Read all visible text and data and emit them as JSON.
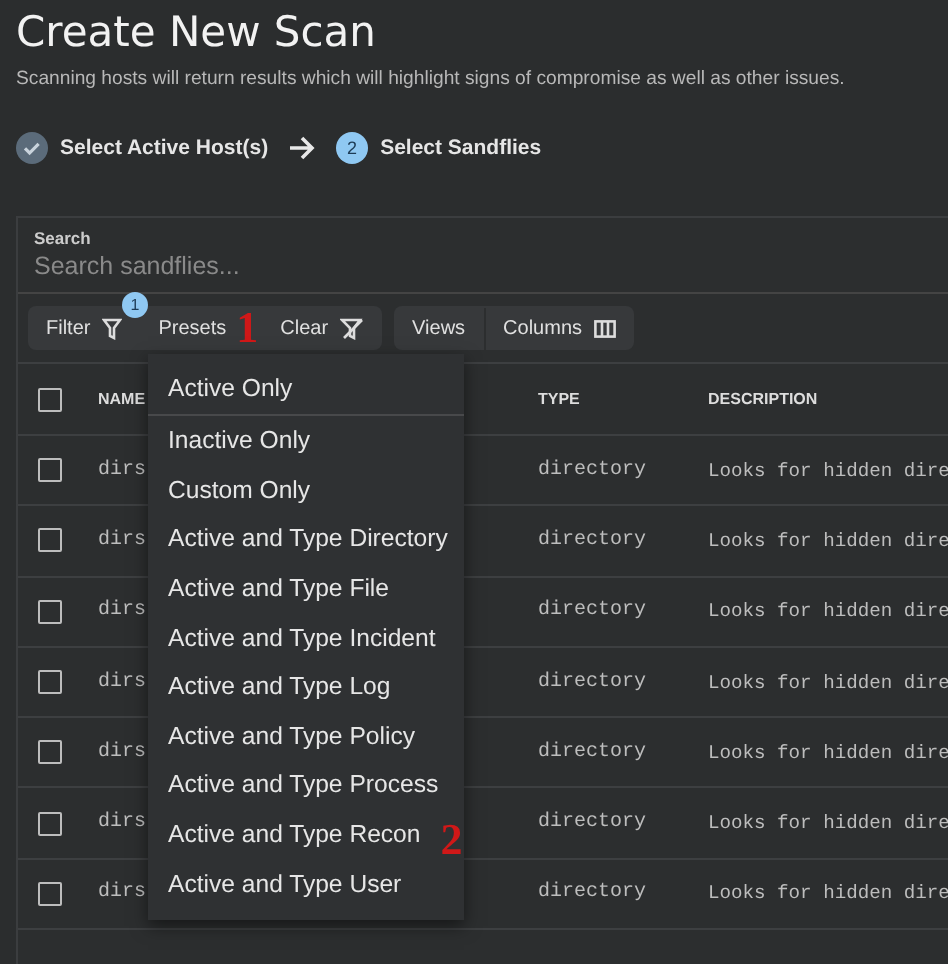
{
  "page": {
    "title": "Create New Scan",
    "subtitle": "Scanning hosts will return results which will highlight signs of compromise as well as other issues."
  },
  "steps": [
    {
      "label": "Select Active Host(s)",
      "done": true
    },
    {
      "label": "Select Sandflies",
      "number": "2",
      "done": false
    }
  ],
  "search": {
    "label": "Search",
    "placeholder": "Search sandflies..."
  },
  "toolbar": {
    "filter": {
      "label": "Filter",
      "badge": "1"
    },
    "presets": {
      "label": "Presets",
      "annotation": "1"
    },
    "clear": "Clear",
    "views": "Views",
    "columns": "Columns"
  },
  "table": {
    "all_checked": false,
    "columns": [
      "NAME",
      "TYPE",
      "DESCRIPTION"
    ],
    "rows": [
      {
        "name": "dirs",
        "type": "directory",
        "description": "Looks for hidden dire",
        "checked": false
      },
      {
        "name": "dirs",
        "type": "directory",
        "description": "Looks for hidden dire",
        "checked": false
      },
      {
        "name": "dirs",
        "type": "directory",
        "description": "Looks for hidden dire",
        "checked": false
      },
      {
        "name": "dirs",
        "type": "directory",
        "description": "Looks for hidden dire",
        "checked": false
      },
      {
        "name": "dirs",
        "type": "directory",
        "description": "Looks for hidden dire",
        "checked": false
      },
      {
        "name": "dirs",
        "type": "directory",
        "description": "Looks for hidden dire",
        "checked": false
      },
      {
        "name": "dirs",
        "type": "directory",
        "description": "Looks for hidden dire",
        "checked": false
      }
    ]
  },
  "presets_menu": {
    "items": [
      {
        "label": "Active Only",
        "selected": true
      },
      {
        "label": "Inactive Only",
        "selected": false
      },
      {
        "label": "Custom Only",
        "selected": false
      },
      {
        "label": "Active and Type Directory",
        "selected": false
      },
      {
        "label": "Active and Type File",
        "selected": false
      },
      {
        "label": "Active and Type Incident",
        "selected": false
      },
      {
        "label": "Active and Type Log",
        "selected": false
      },
      {
        "label": "Active and Type Policy",
        "selected": false
      },
      {
        "label": "Active and Type Process",
        "selected": false
      },
      {
        "label": "Active and Type Recon",
        "selected": false,
        "annotation": "2"
      },
      {
        "label": "Active and Type User",
        "selected": false
      }
    ]
  }
}
